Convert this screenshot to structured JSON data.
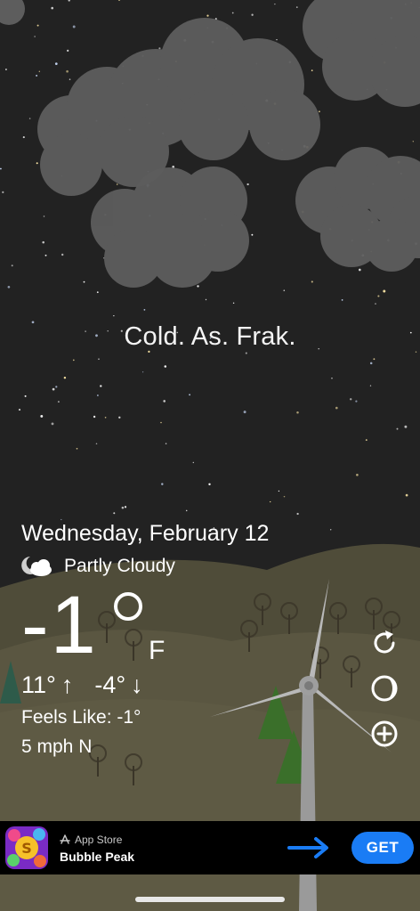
{
  "tagline": "Cold. As. Frak.",
  "weather": {
    "date": "Wednesday, February 12",
    "condition": "Partly Cloudy",
    "condition_icon": "partly-cloudy-night-icon",
    "temperature": "-1",
    "unit": "F",
    "high": "11°",
    "low": "-4°",
    "feels_like": "Feels Like: -1°",
    "wind": "5 mph N"
  },
  "actions": {
    "refresh_icon": "refresh-icon",
    "moon_icon": "moon-phase-icon",
    "add_icon": "add-location-icon"
  },
  "ad": {
    "source": "App Store",
    "title": "Bubble Peak",
    "cta": "GET",
    "accent_color": "#1a7cf5"
  },
  "colors": {
    "sky": "#222222",
    "cloud": "#5a5a5a",
    "hill": "#5a5641"
  }
}
